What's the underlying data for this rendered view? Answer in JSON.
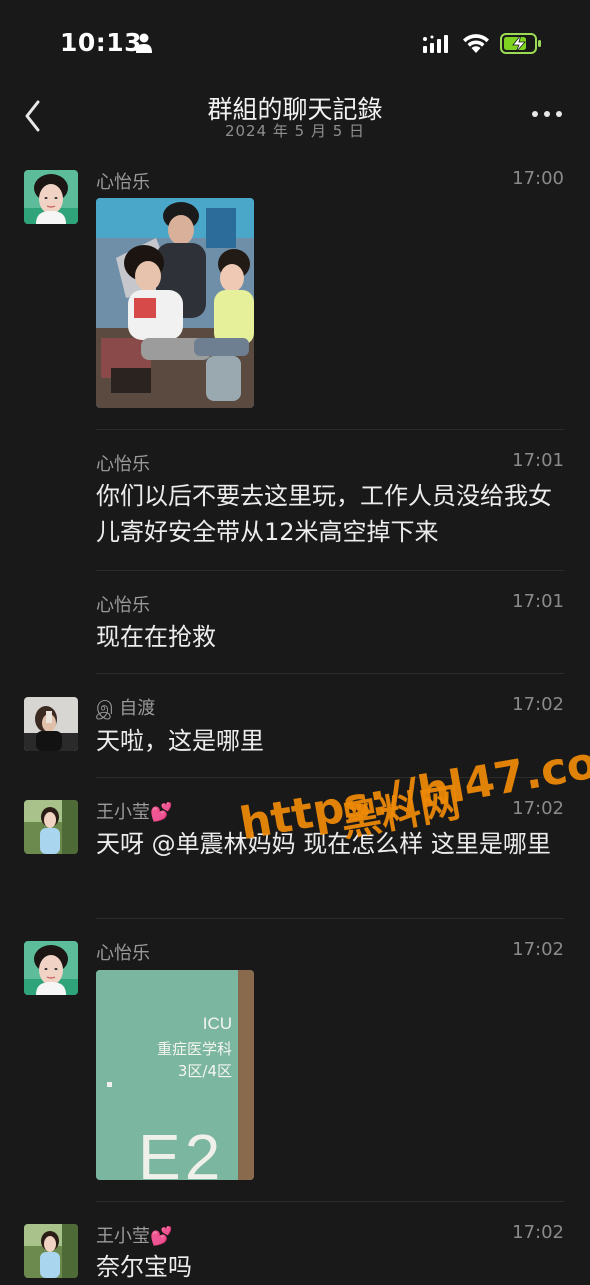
{
  "status_bar": {
    "time": "10:13"
  },
  "nav": {
    "title": "群組的聊天記錄",
    "subtitle": "2024 年 5 月 5 日"
  },
  "messages": [
    {
      "sender": "心怡乐",
      "time": "17:00",
      "type": "image",
      "image_desc": "photo"
    },
    {
      "sender": "心怡乐",
      "time": "17:01",
      "text": "你们以后不要去这里玩，工作人员没给我女儿寄好安全带从12米高空掉下来"
    },
    {
      "sender": "心怡乐",
      "time": "17:01",
      "text": "现在在抢救"
    },
    {
      "sender": "இ 自渡",
      "time": "17:02",
      "text": "天啦，这是哪里"
    },
    {
      "sender": "王小莹💕",
      "time": "17:02",
      "text": "天呀 @单震林妈妈 现在怎么样 这里是哪里"
    },
    {
      "sender": "心怡乐",
      "time": "17:02",
      "type": "image",
      "sign": {
        "l1": "ICU",
        "l2": "重症医学科",
        "l3": "3区/4区",
        "l4": "E2"
      }
    },
    {
      "sender": "王小莹💕",
      "time": "17:02",
      "text": "奈尔宝吗"
    }
  ],
  "watermark": {
    "line1": "黑料网",
    "line2": "https://hl47.co"
  }
}
